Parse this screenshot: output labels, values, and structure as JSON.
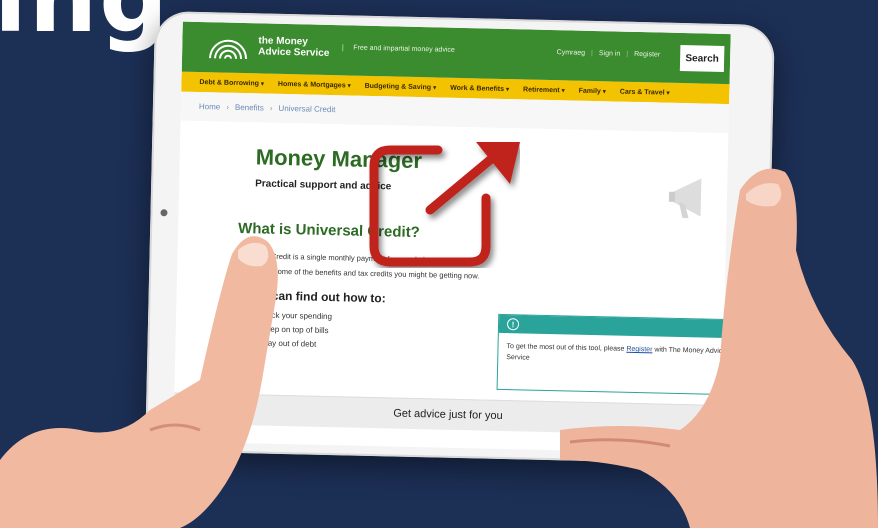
{
  "background_text": "ing",
  "site": {
    "logo_line1": "the Money",
    "logo_line2": "Advice Service",
    "tagline": "Free and impartial money advice",
    "top_links": [
      "Cymraeg",
      "Sign in",
      "Register"
    ],
    "search_label": "Search"
  },
  "nav": {
    "items": [
      "Debt & Borrowing",
      "Homes & Mortgages",
      "Budgeting & Saving",
      "Work & Benefits",
      "Retirement",
      "Family",
      "Cars & Travel"
    ]
  },
  "breadcrumb": [
    "Home",
    "Benefits",
    "Universal Credit"
  ],
  "page": {
    "title": "Money Manager",
    "subtitle": "Practical support and advice",
    "section_title": "What is Universal Credit?",
    "para_line1": "Universal Credit is a single monthly payment for people in or out of work.",
    "para_line2": "It replaces some of the benefits and tax credits you might be getting now.",
    "find_title": "You can find out how to:",
    "find_items": [
      "track your spending",
      "keep on top of bills",
      "stay out of debt"
    ],
    "info_text_before": "To get the most out of this tool, please",
    "info_link": "Register",
    "info_text_after": "with The Money Advice Service",
    "advice_bar": "Get advice just for you"
  },
  "colors": {
    "background": "#1c2f55",
    "header_green": "#3b8b2f",
    "nav_yellow": "#f3c200",
    "title_green": "#2d6b25",
    "info_teal": "#2aa39a",
    "overlay_red": "#c0201a"
  },
  "icons": {
    "overlay": "external-link-icon",
    "info": "exclamation-icon"
  }
}
